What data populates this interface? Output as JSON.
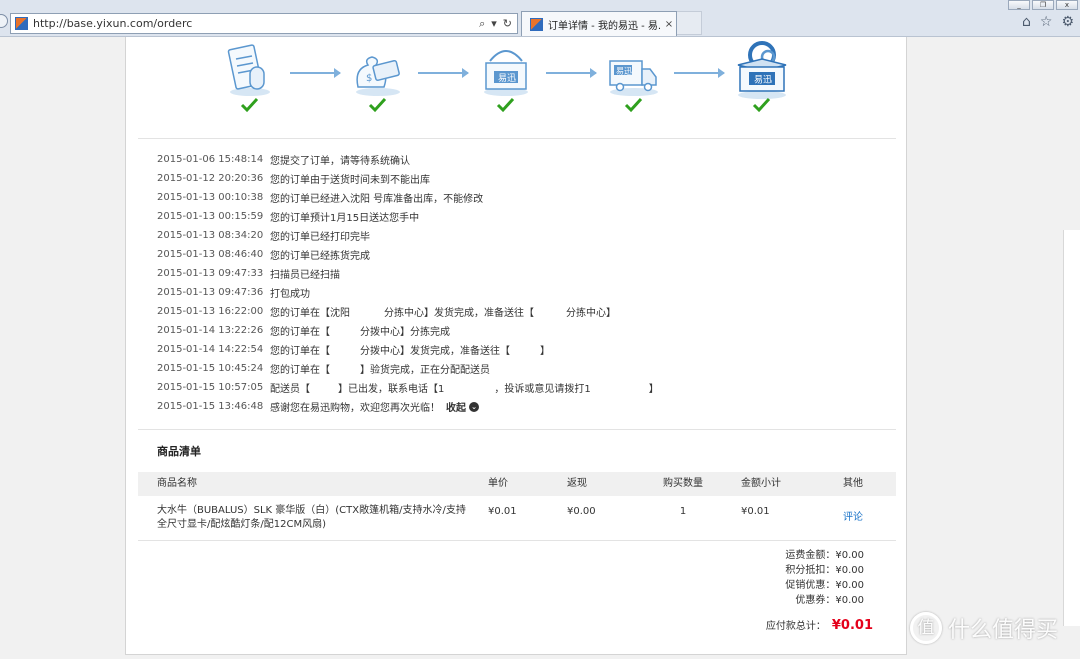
{
  "browser": {
    "url": "http://base.yixun.com/orderc",
    "tab_title": "订单详情 - 我的易迅 - 易...",
    "tab_close": "×",
    "search_glyph": "⌕",
    "dropdown_glyph": "▾",
    "refresh_glyph": "↻",
    "home_glyph": "⌂",
    "favorites_glyph": "☆",
    "settings_glyph": "⚙",
    "win_minimize": "_",
    "win_restore": "❐",
    "win_close": "x"
  },
  "progress": {
    "steps": [
      {
        "icon": "order-form-icon",
        "done": true
      },
      {
        "icon": "payment-card-icon",
        "done": true
      },
      {
        "icon": "warehouse-box-icon",
        "done": true
      },
      {
        "icon": "delivery-truck-icon",
        "done": true
      },
      {
        "icon": "received-package-icon",
        "done": true
      }
    ],
    "logo_text": "易迅",
    "check_color": "#2fa01e",
    "icon_color": "#5b97cf"
  },
  "log": [
    {
      "time": "2015-01-06 15:48:14",
      "msg": "您提交了订单，请等待系统确认"
    },
    {
      "time": "2015-01-12 20:20:36",
      "msg": "您的订单由于送货时间未到不能出库"
    },
    {
      "time": "2015-01-13 00:10:38",
      "msg": "您的订单已经进入沈阳 号库准备出库，不能修改"
    },
    {
      "time": "2015-01-13 00:15:59",
      "msg": "您的订单预计1月15日送达您手中"
    },
    {
      "time": "2015-01-13 08:34:20",
      "msg": "您的订单已经打印完毕"
    },
    {
      "time": "2015-01-13 08:46:40",
      "msg": "您的订单已经拣货完成"
    },
    {
      "time": "2015-01-13 09:47:33",
      "msg": "扫描员已经扫描"
    },
    {
      "time": "2015-01-13 09:47:36",
      "msg": "打包成功"
    },
    {
      "time": "2015-01-13 16:22:00",
      "msg_a": "您的订单在【沈阳",
      "msg_b": "分拣中心】发货完成，准备送往【",
      "msg_c": "分拣中心】"
    },
    {
      "time": "2015-01-14 13:22:26",
      "msg_a": "您的订单在【",
      "msg_b": "分拨中心】分拣完成"
    },
    {
      "time": "2015-01-14 14:22:54",
      "msg_a": "您的订单在【",
      "msg_b": "分拨中心】发货完成，准备送往【",
      "msg_c": "】"
    },
    {
      "time": "2015-01-15 10:45:24",
      "msg_a": "您的订单在【",
      "msg_b": "】验货完成，正在分配配送员"
    },
    {
      "time": "2015-01-15 10:57:05",
      "msg_a": "配送员【",
      "msg_b": "】已出发，联系电话【1",
      "msg_c": "，投诉或意见请拨打1",
      "msg_d": "】"
    },
    {
      "time": "2015-01-15 13:46:48",
      "msg": "感谢您在易迅购物，欢迎您再次光临！",
      "toggle": "收起",
      "toggle_glyph": "⌄"
    }
  ],
  "goods": {
    "title": "商品清单",
    "columns": [
      "商品名称",
      "单价",
      "返现",
      "购买数量",
      "金额小计",
      "其他"
    ],
    "rows": [
      {
        "name": "大水牛（BUBALUS）SLK 豪华版（白）(CTX敞篷机箱/支持水冷/支持全尺寸显卡/配炫酷灯条/配12CM风扇)",
        "price": "¥0.01",
        "cashback": "¥0.00",
        "qty": "1",
        "subtotal": "¥0.01",
        "action": "评论"
      }
    ]
  },
  "summary": {
    "shipping": "运费金额：¥0.00",
    "points": "积分抵扣：¥0.00",
    "promo": "促销优惠：¥0.00",
    "coupon": "优惠券：¥0.00",
    "total_label": "应付款总计：",
    "total_value": "¥0.01",
    "total_color": "#e4001b"
  },
  "watermark": {
    "badge": "值",
    "text": "什么值得买"
  }
}
